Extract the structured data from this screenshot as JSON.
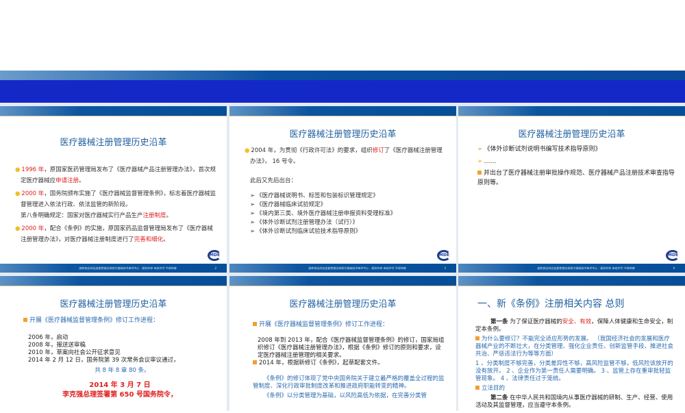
{
  "footer_text": "国家食品药品监督管理总局医疗器械技术审评中心 . 版权所有 未经许可 不得转载",
  "logo": "MDE",
  "slides": [
    {
      "title": "医疗器械注册管理历史沿革",
      "page": "2",
      "b1_year": "1996 年",
      "b1_text": "，原国家医药管理局发布了《医疗器械产品注册管理办法》，首次规定医疗器械应",
      "b1_red": "申请注册",
      "b1_end": "。",
      "b2_year": "2000 年",
      "b2_text": "，国务院颁布实施了《医疗器械监督管理条例》，标志着医疗器械监督管理进入依法行政、依法监管的新阶段。",
      "b2_sub": "第八条明确规定：国家对医疗器械实行产品生产",
      "b2_red": "注册制度",
      "b2_end": "。",
      "b3_year": "2000  年",
      "b3_text": "，配合《条例》的实施，原国家药品监督管理局发布了《医疗器械注册管理办法》，对医疗器械注册制度进行了",
      "b3_red": "完善和细化",
      "b3_end": "。"
    },
    {
      "title": "医疗器械注册管理历史沿革",
      "page": "3",
      "b1_text": "2004 年，为贯彻《行政许可法》的要求，组织",
      "b1_red": "修订",
      "b1_end": "了《医疗器械注册管理办法》， 16 号令。",
      "intro": "此后又先后出台：",
      "items": [
        "《医疗器械说明书、标签和包装标识管理规定》",
        "《医疗器械临床试验规定》",
        "《境内第三类、境外医疗器械注册申报资料受理标准》",
        "《体外诊断试剂注册管理办法（试行）》",
        "《体外诊断试剂临床试验技术指导原则》"
      ]
    },
    {
      "title": "医疗器械注册管理历史沿革",
      "page": "4",
      "items": [
        "《体外诊断试剂说明书编写技术指导原则》",
        "……"
      ],
      "b1": "并出台了医疗器械注册审批操作规范、医疗器械产品注册技术审查指导原则等。"
    },
    {
      "title": "医疗器械注册管理历史沿革",
      "heading": "开展《医疗器械监督管理条例》修订工作进程：",
      "lines": [
        "2006 年，启动",
        "2008 年，报送送审稿",
        "2010 年，草案向社会公开征求意见",
        "2014 年 2 月 12 日，国务院第 39 次常务会议审议通过，"
      ],
      "summary": "共  8 年 8 章 80 条。",
      "date": "2014 年 3 月 7 日",
      "sign": "李克强总理签署第 650 号国务院令，"
    },
    {
      "title": "医疗器械注册管理历史沿革",
      "heading": "开展《医疗器械监督管理条例》修订工作进程：",
      "para": "2008 年到 2013 年，配合《医疗器械监督管理条例》的修订，国家局组织修订《医疗器械注册管理办法》，根据《条例》修订的原则和要求，设定医疗器械注册管理的相关要求。",
      "b2": "2014 年，根据新修订《条例》，起草配套文件。",
      "q1": "《条例》的修订体现了党中央国务院关于建立最严格的覆盖全过程的监管制度、深化行政审批制度改革和推进政府职能转变的精神。",
      "q2": "《条例》以分类管理为基础，以风险高低为依据，在完善分类管"
    },
    {
      "title": "一、新《条例》注册相关内容    总则",
      "a1_label": "第一条",
      "a1_text": "   为了保证医疗器械的",
      "a1_red": "安全、有效",
      "a1_end": "，保障人体健康和生命安全，制定本条例。",
      "why": "为什么要修订？不能完全适应形势的发展。 （我国经济社会的发展和医疗器械产业的不断壮大，在分类管理、强化企业责任、创新监管手段、推进社会共治、严惩违法行为等等方面）",
      "reasons": "1 、分类制度不够完善，分类差异性不够，高风险监管不够，低风险该放开的没有放开。 2 、企业作为第一责任人需要明确。 3 、监管上存在重审批轻监管现象。 4 、法律责任过于笼统。",
      "purpose": "立法目的",
      "a2_label": "第二条",
      "a2_text": "   在中华人民共和国境内从事医疗器械的研制、生产、经营、使用活动及其监督管理，应当遵守本条例。"
    }
  ]
}
